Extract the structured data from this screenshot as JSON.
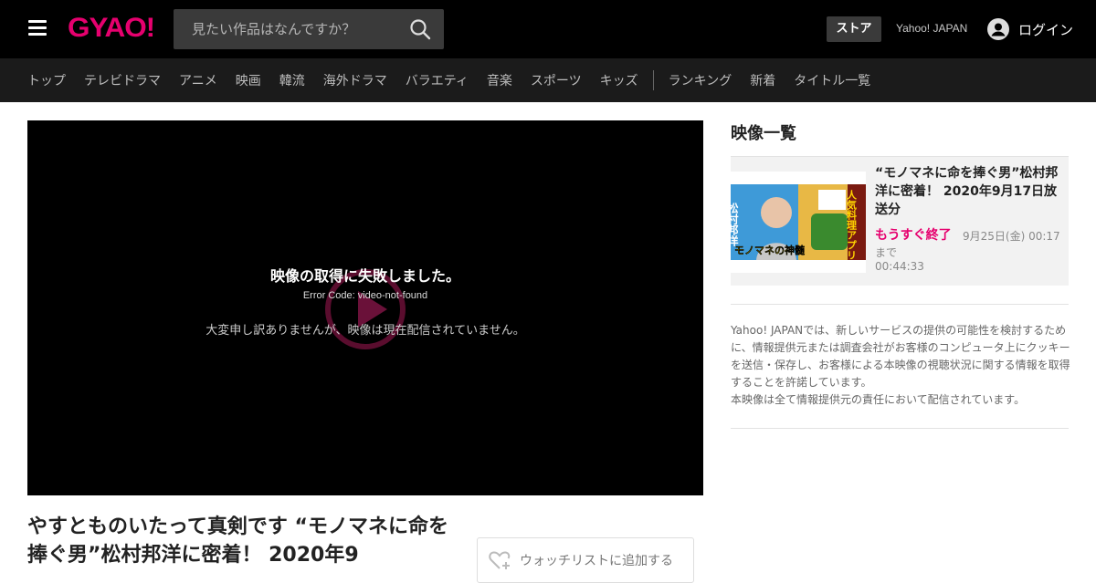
{
  "header": {
    "logo_text": "GYAO!",
    "search_placeholder": "見たい作品はなんですか？",
    "store_label": "ストア",
    "yahoo_label": "Yahoo! JAPAN",
    "login_label": "ログイン",
    "brand_color": "#e6006e"
  },
  "nav": {
    "items": [
      "トップ",
      "テレビドラマ",
      "アニメ",
      "映画",
      "韓流",
      "海外ドラマ",
      "バラエティ",
      "音楽",
      "スポーツ",
      "キッズ"
    ],
    "extra_items": [
      "ランキング",
      "新着",
      "タイトル一覧"
    ]
  },
  "player": {
    "error_title": "映像の取得に失敗しました。",
    "error_code": "Error Code: video-not-found",
    "error_message": "大変申し訳ありませんが、映像は現在配信されていません。"
  },
  "video": {
    "title": "やすとものいたって真剣です “モノマネに命を捧ぐ男”松村邦洋に密着！ 2020年9",
    "watchlist_label": "ウォッチリストに追加する"
  },
  "sidebar": {
    "heading": "映像一覧",
    "item": {
      "title": "“モノマネに命を捧ぐ男”松村邦洋に密着！ 2020年9月17日放送分",
      "soon_label": "もうすぐ終了",
      "available_until": "9月25日(金) 00:17まで",
      "duration": "00:44:33",
      "thumb_text_left": "松村邦洋",
      "thumb_text_caption": "モノマネの神髄",
      "thumb_text_right": "人気料理アプリ"
    },
    "notice_1": "Yahoo! JAPANでは、新しいサービスの提供の可能性を検討するために、情報提供元または調査会社がお客様のコンピュータ上にクッキーを送信・保存し、お客様による本映像の視聴状況に関する情報を取得することを許諾しています。",
    "notice_2": "本映像は全て情報提供元の責任において配信されています。"
  }
}
